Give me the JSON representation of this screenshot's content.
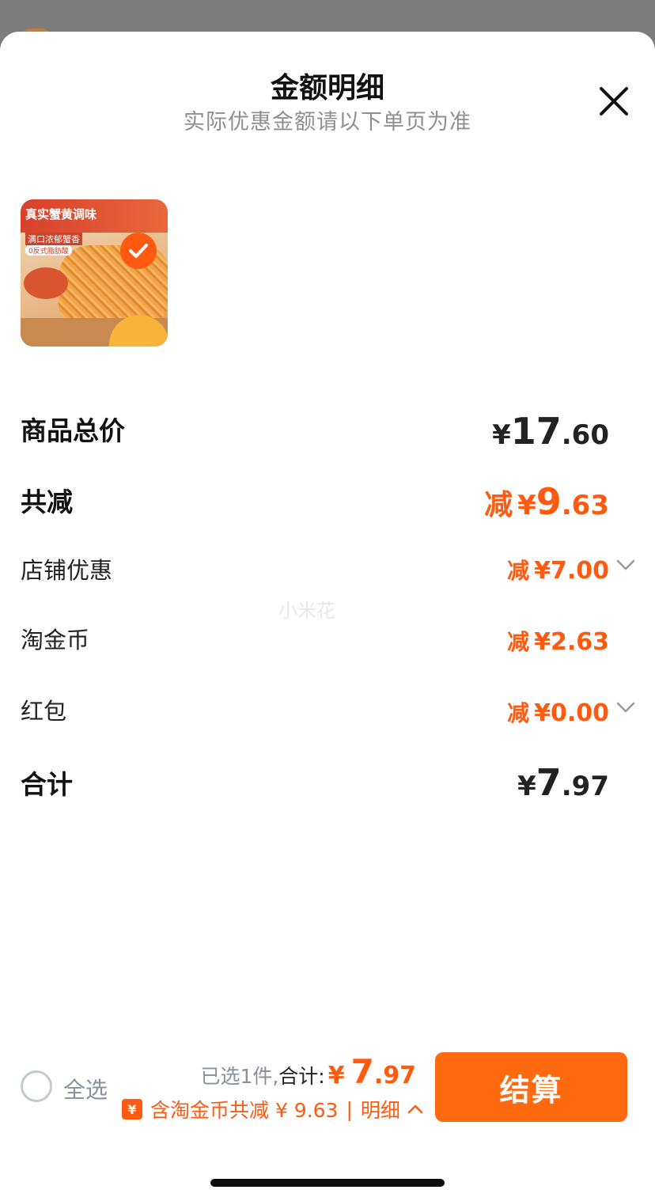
{
  "header": {
    "title": "金额明细",
    "subtitle": "实际优惠金额请以下单页为准",
    "close_icon": "close-icon"
  },
  "product": {
    "thumbnail_text": [
      "真实蟹黄调味",
      "满口浓郁蟹香",
      "0反式脂肪酸"
    ],
    "selected": true
  },
  "breakdown": {
    "total_price": {
      "label": "商品总价",
      "symbol": "¥",
      "int": "17",
      "dec": ".60"
    },
    "total_discount": {
      "label": "共减",
      "prefix": "减",
      "symbol": "¥",
      "int": "9",
      "dec": ".63"
    },
    "store_discount": {
      "label": "店铺优惠",
      "prefix": "减",
      "value": "¥7.00"
    },
    "coins": {
      "label": "淘金币",
      "prefix": "减",
      "value": "¥2.63"
    },
    "red_packet": {
      "label": "红包",
      "prefix": "减",
      "value": "¥0.00"
    },
    "subtotal": {
      "label": "合计",
      "symbol": "¥",
      "int": "7",
      "dec": ".97"
    }
  },
  "watermark": "小米花",
  "footer": {
    "select_all": "全选",
    "selected_text": "已选1件,",
    "total_label": "合计:",
    "total_symbol": "¥",
    "total_int": "7",
    "total_dec": ".97",
    "coin_badge": "¥",
    "coin_text": "含淘金币共减 ¥ 9.63",
    "detail_text": "明细",
    "checkout": "结算"
  },
  "colors": {
    "accent": "#ff5a10",
    "text": "#222222",
    "muted": "#8f8f8f"
  }
}
